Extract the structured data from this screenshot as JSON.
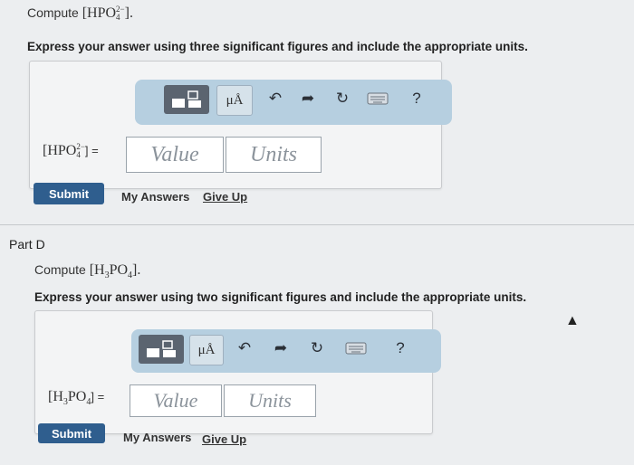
{
  "part_c": {
    "compute_prefix": "Compute",
    "compute_math": "[HPO",
    "compute_sub": "4",
    "compute_sup": "2−",
    "compute_close": "].",
    "instruction": "Express your answer using three significant figures and include the appropriate units.",
    "answer_label_math": "[HPO",
    "answer_label_sub": "4",
    "answer_label_sup": "2−",
    "answer_label_close": "] =",
    "value_placeholder": "Value",
    "units_placeholder": "Units",
    "submit_label": "Submit",
    "my_answers_label": "My Answers",
    "give_up_label": "Give Up"
  },
  "part_d": {
    "part_label": "Part D",
    "compute_prefix": "Compute",
    "compute_math": "[H",
    "compute_sub1": "3",
    "compute_mid": "PO",
    "compute_sub2": "4",
    "compute_close": "].",
    "instruction": "Express your answer using two significant figures and include the appropriate units.",
    "answer_label_math": "[H",
    "answer_label_sub1": "3",
    "answer_label_mid": "PO",
    "answer_label_sub2": "4",
    "answer_label_close": "] =",
    "value_placeholder": "Value",
    "units_placeholder": "Units",
    "submit_label": "Submit",
    "my_answers_label": "My Answers",
    "give_up_label": "Give Up"
  },
  "toolbar": {
    "units_button_label": "μÅ",
    "help_label": "?",
    "icons": [
      "templates-icon",
      "units-icon",
      "undo-icon",
      "redo-icon",
      "reset-icon",
      "keyboard-icon",
      "help-icon"
    ]
  }
}
